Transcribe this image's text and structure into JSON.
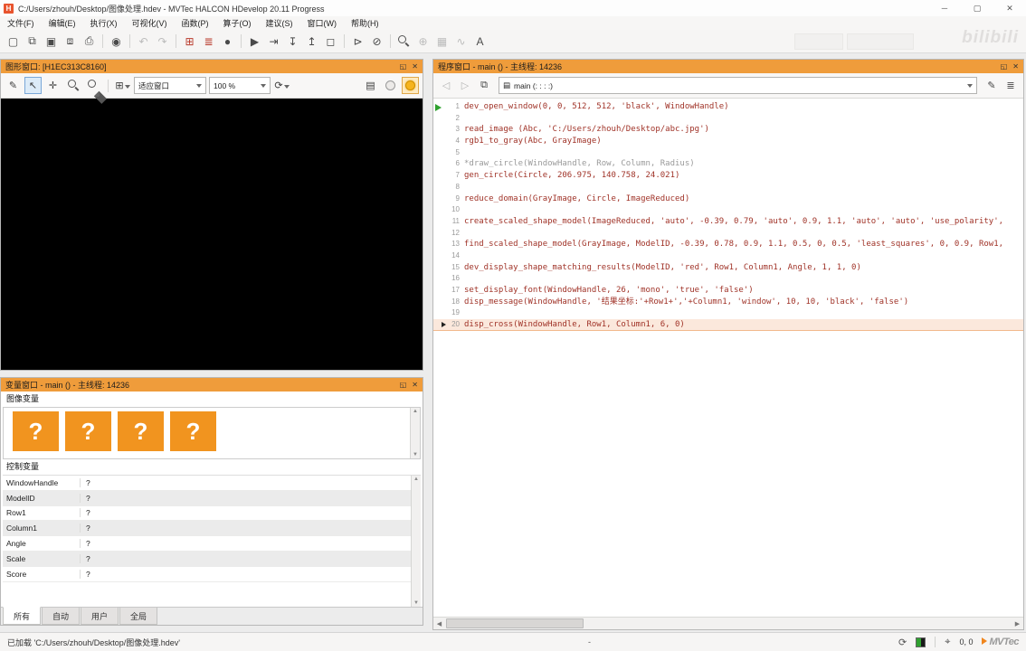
{
  "titlebar": {
    "title": "C:/Users/zhouh/Desktop/图像处理.hdev - MVTec HALCON HDevelop 20.11 Progress",
    "app_initial": "H",
    "minimize": "─",
    "maximize": "▢",
    "close": "✕"
  },
  "menu": {
    "items": [
      "文件(F)",
      "编辑(E)",
      "执行(X)",
      "可视化(V)",
      "函数(P)",
      "算子(O)",
      "建议(S)",
      "窗口(W)",
      "帮助(H)"
    ]
  },
  "main_toolbar": {
    "icons": [
      {
        "name": "new-program-icon",
        "glyph": "▢"
      },
      {
        "name": "open-program-icon",
        "glyph": "⧉"
      },
      {
        "name": "save-program-icon",
        "glyph": "▣"
      },
      {
        "name": "save-all-icon",
        "glyph": "⧈"
      },
      {
        "name": "print-icon",
        "glyph": "⎙"
      },
      {
        "name": "separator",
        "cls": "sep"
      },
      {
        "name": "image-acquisition-icon",
        "glyph": "◉"
      },
      {
        "name": "separator",
        "cls": "sep"
      },
      {
        "name": "undo-icon",
        "glyph": "↶",
        "cls": "dis"
      },
      {
        "name": "redo-icon",
        "glyph": "↷",
        "cls": "dis"
      },
      {
        "name": "separator",
        "cls": "sep"
      },
      {
        "name": "operator-window-icon",
        "glyph": "⊞",
        "cls": "red"
      },
      {
        "name": "operator-insert-icon",
        "glyph": "≣",
        "cls": "red"
      },
      {
        "name": "full-image-icon",
        "glyph": "●"
      },
      {
        "name": "separator",
        "cls": "sep"
      },
      {
        "name": "run-icon",
        "glyph": "▶"
      },
      {
        "name": "step-over-icon",
        "glyph": "⇥"
      },
      {
        "name": "step-into-icon",
        "glyph": "↧"
      },
      {
        "name": "step-out-icon",
        "glyph": "↥"
      },
      {
        "name": "stop-icon",
        "glyph": "◻"
      },
      {
        "name": "separator",
        "cls": "sep"
      },
      {
        "name": "activate-line-icon",
        "glyph": "⊳"
      },
      {
        "name": "deactivate-line-icon",
        "glyph": "⊘"
      },
      {
        "name": "separator",
        "cls": "sep"
      },
      {
        "name": "search-icon",
        "cls": "mag"
      },
      {
        "name": "zoom-in-icon",
        "glyph": "⊕",
        "cls": "dis"
      },
      {
        "name": "profiler-icon",
        "glyph": "▦",
        "cls": "dis"
      },
      {
        "name": "measure-icon",
        "glyph": "∿",
        "cls": "dis"
      },
      {
        "name": "font-settings-icon",
        "glyph": "A"
      }
    ]
  },
  "watermark": "bilibili",
  "panel_buttons": {
    "float": "◱",
    "close": "✕"
  },
  "graphics_window": {
    "title": "图形窗口: [H1EC313C8160]",
    "toolbar": {
      "tools": [
        {
          "name": "draw-icon",
          "glyph": "✎"
        },
        {
          "name": "pointer-icon",
          "glyph": "↖",
          "cls": "sel"
        },
        {
          "name": "hand-icon",
          "glyph": "✛"
        },
        {
          "name": "magnify-icon",
          "cls": "mag"
        },
        {
          "name": "zoom-mode-icon",
          "cls": "mag arrow"
        },
        {
          "name": "separator",
          "cls": "sep"
        },
        {
          "name": "grid-select-icon",
          "glyph": "⊞",
          "cls": "arrow"
        }
      ],
      "fit_label": "适应窗口",
      "zoom_value": "100 %",
      "rotate_glyph": "⟳",
      "right_tools": [
        {
          "name": "layers-icon",
          "glyph": "▤"
        },
        {
          "name": "bulb-off-icon",
          "cls": "bulb off"
        },
        {
          "name": "bulb-on-icon",
          "cls": "bulb on"
        }
      ]
    }
  },
  "variable_window": {
    "title": "变量窗口 - main () - 主线程: 14236",
    "image_section_label": "图像变量",
    "image_tiles": [
      "?",
      "?",
      "?",
      "?"
    ],
    "scroll_up": "▲",
    "scroll_down": "▼",
    "control_section_label": "控制变量",
    "control_vars": [
      {
        "varname": "WindowHandle",
        "value": "?"
      },
      {
        "varname": "ModelID",
        "value": "?"
      },
      {
        "varname": "Row1",
        "value": "?"
      },
      {
        "varname": "Column1",
        "value": "?"
      },
      {
        "varname": "Angle",
        "value": "?"
      },
      {
        "varname": "Scale",
        "value": "?"
      },
      {
        "varname": "Score",
        "value": "?"
      }
    ],
    "tabs": [
      {
        "label": "所有",
        "cls": "active"
      },
      {
        "label": "自动"
      },
      {
        "label": "用户"
      },
      {
        "label": "全局"
      }
    ]
  },
  "program_window": {
    "title": "程序窗口 - main () - 主线程: 14236",
    "toolbar": {
      "back_glyph": "◁",
      "fwd_glyph": "▷",
      "doc_glyph": "⧉",
      "combo_icon": "▤",
      "combo_label": "main (: : : :)",
      "edit_glyph": "✎",
      "list_glyph": "≣"
    },
    "scroll_left": "◀",
    "scroll_right": "▶",
    "lines": [
      {
        "n": 1,
        "t": "dev_open_window(0, 0, 512, 512, 'black', WindowHandle)",
        "cls": "m-run"
      },
      {
        "n": 2,
        "t": ""
      },
      {
        "n": 3,
        "t": "read_image (Abc, 'C:/Users/zhouh/Desktop/abc.jpg')"
      },
      {
        "n": 4,
        "t": "rgb1_to_gray(Abc, GrayImage)"
      },
      {
        "n": 5,
        "t": ""
      },
      {
        "n": 6,
        "t": "*draw_circle(WindowHandle, Row, Column, Radius)",
        "cls": "comment"
      },
      {
        "n": 7,
        "t": "gen_circle(Circle, 206.975, 140.758, 24.021)"
      },
      {
        "n": 8,
        "t": ""
      },
      {
        "n": 9,
        "t": "reduce_domain(GrayImage, Circle, ImageReduced)"
      },
      {
        "n": 10,
        "t": ""
      },
      {
        "n": 11,
        "t": "create_scaled_shape_model(ImageReduced, 'auto', -0.39, 0.79, 'auto', 0.9, 1.1, 'auto', 'auto', 'use_polarity',"
      },
      {
        "n": 12,
        "t": ""
      },
      {
        "n": 13,
        "t": "find_scaled_shape_model(GrayImage, ModelID, -0.39, 0.78, 0.9, 1.1, 0.5, 0, 0.5, 'least_squares', 0, 0.9, Row1,"
      },
      {
        "n": 14,
        "t": ""
      },
      {
        "n": 15,
        "t": "dev_display_shape_matching_results(ModelID, 'red', Row1, Column1, Angle, 1, 1, 0)"
      },
      {
        "n": 16,
        "t": ""
      },
      {
        "n": 17,
        "t": "set_display_font(WindowHandle, 26, 'mono', 'true', 'false')"
      },
      {
        "n": 18,
        "t": "disp_message(WindowHandle, '结果坐标:'+Row1+','+Column1, 'window', 10, 10, 'black', 'false')"
      },
      {
        "n": 19,
        "t": ""
      },
      {
        "n": 20,
        "t": "disp_cross(WindowHandle, Row1, Column1, 6, 0)",
        "cls": "hl m-ic"
      }
    ]
  },
  "status_bar": {
    "left": "已加载 'C:/Users/zhouh/Desktop/图像处理.hdev'",
    "center": "-",
    "refresh_glyph": "⟳",
    "coords_glyph": "⌖",
    "coords": "0, 0",
    "logo": "MVTec"
  }
}
